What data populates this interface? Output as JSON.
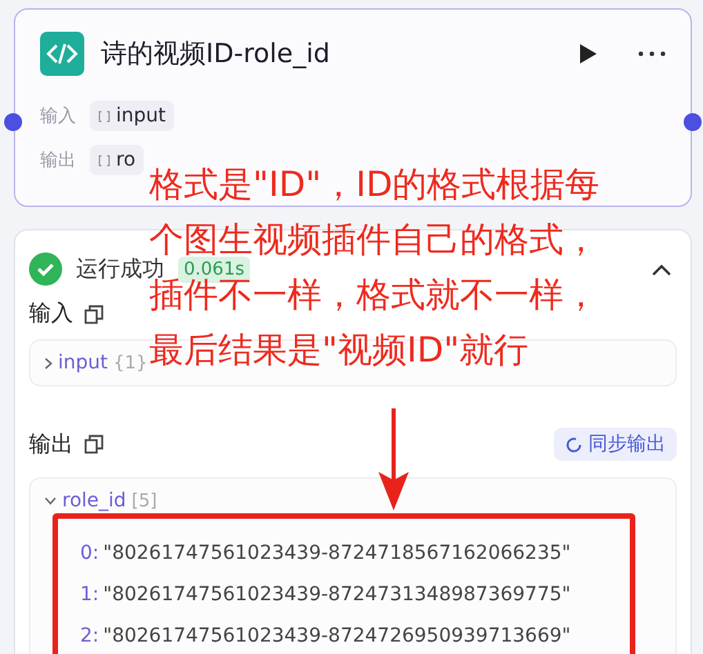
{
  "node": {
    "title": "诗的视频ID-role_id",
    "params": [
      {
        "label": "输入",
        "tag": "input"
      },
      {
        "label": "输出",
        "tag": "ro"
      }
    ]
  },
  "run": {
    "status": "运行成功",
    "time": "0.061s",
    "expanded": true,
    "input": {
      "label": "输入",
      "field": "input",
      "count": "{1}"
    },
    "output": {
      "label": "输出",
      "sync_button": "同步输出",
      "field": "role_id",
      "count": "[5]",
      "items": [
        {
          "index": "0:",
          "value": "\"80261747561023439-8724718567162066235\""
        },
        {
          "index": "1:",
          "value": "\"80261747561023439-8724731348987369775\""
        },
        {
          "index": "2:",
          "value": "\"80261747561023439-8724726950939713669\""
        }
      ]
    }
  },
  "annotation": {
    "lines": [
      "格式是\"ID\"，ID的格式根据每",
      "个图生视频插件自己的格式，",
      "插件不一样，格式就不一样，",
      "最后结果是\"视频ID\"就行"
    ]
  }
}
